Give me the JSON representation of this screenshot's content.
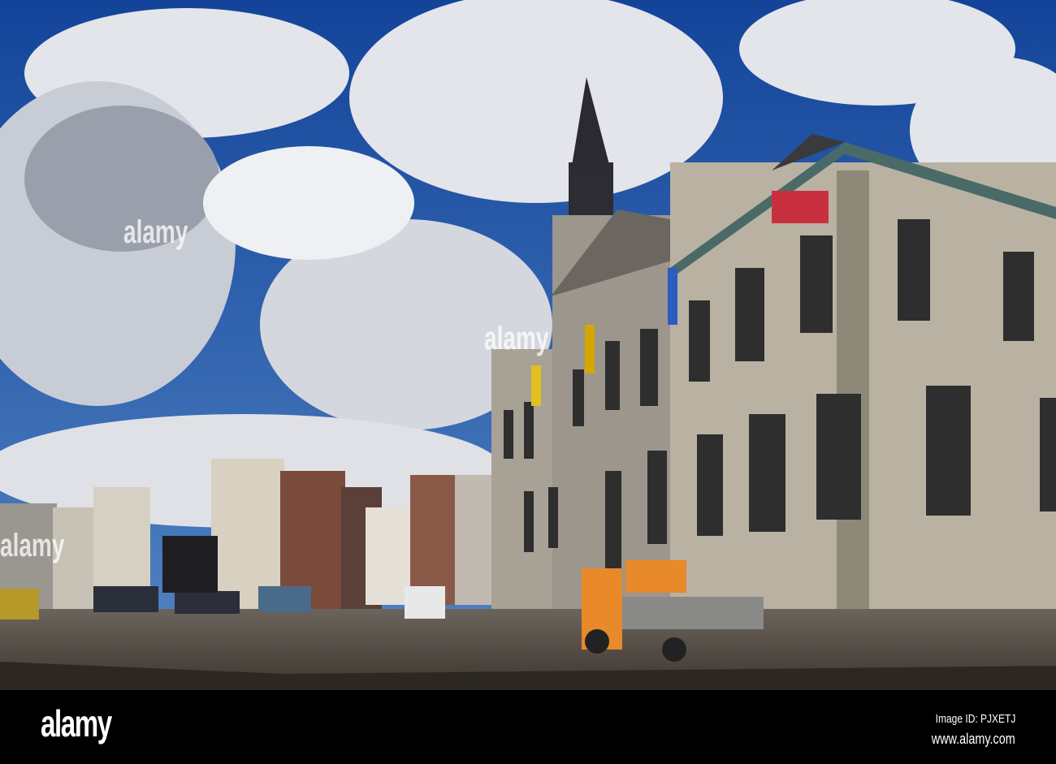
{
  "watermark": {
    "text": "alamy"
  },
  "footer": {
    "logo": "alamy",
    "image_id": "Image ID: PJXETJ",
    "url": "www.alamy.com"
  },
  "colors": {
    "sky": "#1d4f9a",
    "cloud": "#e6e8ec",
    "facade": "#b9b2a3",
    "ground": "#5a5148",
    "truck": "#e8892a",
    "bar": "#000000"
  }
}
